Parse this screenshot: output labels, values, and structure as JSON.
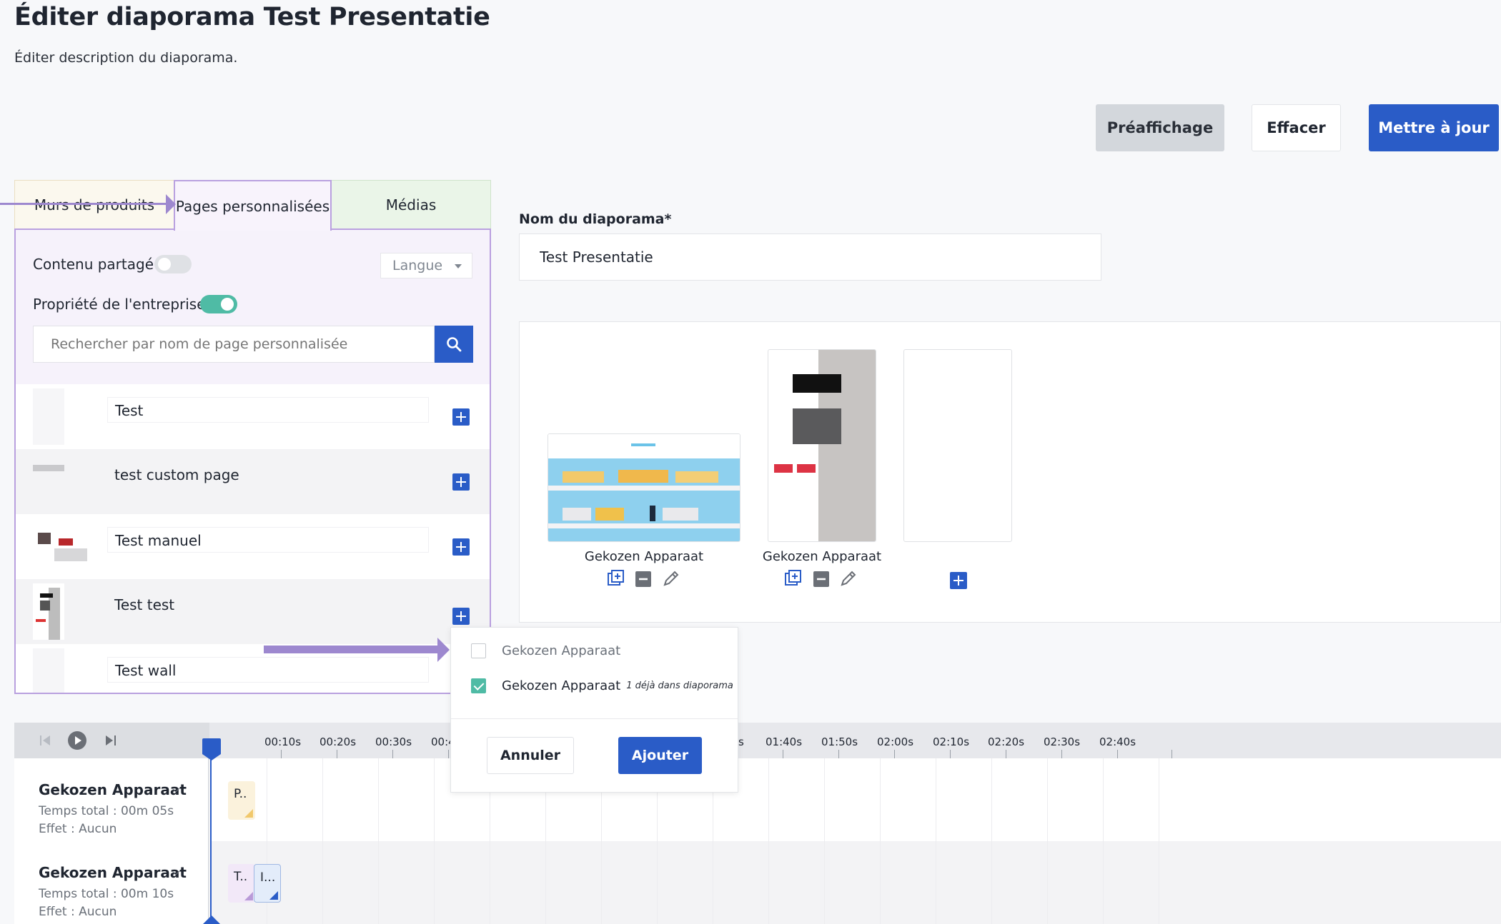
{
  "header": {
    "title": "Éditer diaporama Test Presentatie",
    "subtitle": "Éditer description du diaporama."
  },
  "actions": {
    "preview": "Préaffichage",
    "clear": "Effacer",
    "update": "Mettre à jour"
  },
  "tabs": {
    "product_walls": "Murs de produits",
    "custom_pages": "Pages personnalisées",
    "media": "Médias"
  },
  "filters": {
    "shared_content": "Contenu partagé",
    "shared_content_on": false,
    "company_property": "Propriété de l'entreprise",
    "company_property_on": true,
    "language": "Langue",
    "search_placeholder": "Rechercher par nom de page personnalisée"
  },
  "pages": [
    {
      "name": "Test"
    },
    {
      "name": "test custom page"
    },
    {
      "name": "Test manuel"
    },
    {
      "name": "Test test"
    },
    {
      "name": "Test wall"
    }
  ],
  "slideshow": {
    "name_label": "Nom du diaporama*",
    "name_value": "Test Presentatie",
    "slides": [
      {
        "caption": "Gekozen Apparaat"
      },
      {
        "caption": "Gekozen Apparaat"
      }
    ]
  },
  "popover": {
    "options": [
      {
        "label": "Gekozen Apparaat",
        "checked": false,
        "note": ""
      },
      {
        "label": "Gekozen Apparaat",
        "checked": true,
        "note": "1 déjà dans diaporama"
      }
    ],
    "cancel": "Annuler",
    "add": "Ajouter"
  },
  "timeline": {
    "times_before": [
      "00:10s",
      "00:20s",
      "00:30s",
      "00:4"
    ],
    "times_after": [
      "s",
      "01:40s",
      "01:50s",
      "02:00s",
      "02:10s",
      "02:20s",
      "02:30s",
      "02:40s"
    ],
    "tracks": [
      {
        "title": "Gekozen Apparaat",
        "total": "Temps total : 00m 05s",
        "effect": "Effet : Aucun",
        "clips": [
          "P.."
        ]
      },
      {
        "title": "Gekozen Apparaat",
        "total": "Temps total : 00m 10s",
        "effect": "Effet : Aucun",
        "clips": [
          "T..",
          "I..."
        ]
      }
    ]
  },
  "colors": {
    "primary": "#2a5cc7",
    "accent_toggle": "#4fbba5",
    "highlight_border": "#b9a0df"
  }
}
